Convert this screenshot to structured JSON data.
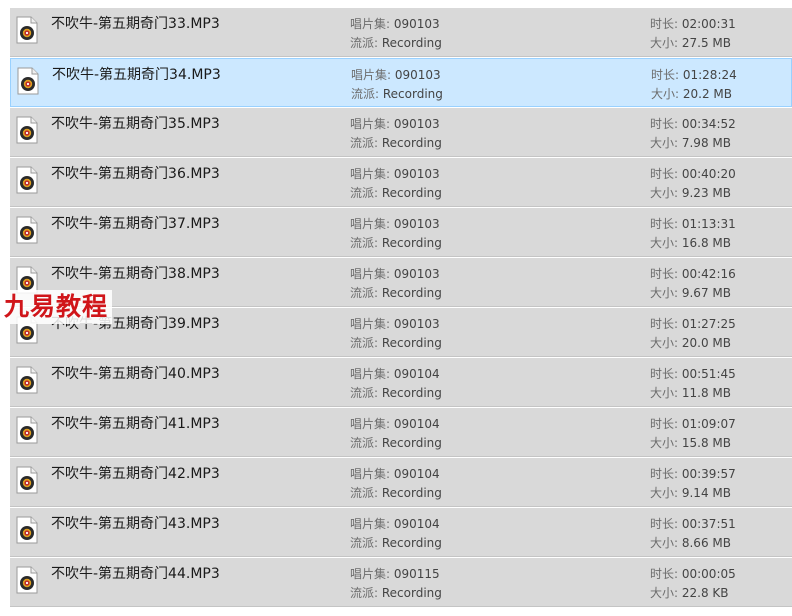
{
  "labels": {
    "album": "唱片集: ",
    "genre": "流派: ",
    "duration": "时长: ",
    "size": "大小: "
  },
  "colors": {
    "row_background": "#d9d9d9",
    "selected_background": "#cce8ff",
    "selected_border": "#99d1ff",
    "watermark": "#d0151a"
  },
  "files": [
    {
      "name": "不吹牛-第五期奇门33.MP3",
      "album": "090103",
      "genre": "Recording",
      "duration": "02:00:31",
      "size": "27.5 MB",
      "selected": false
    },
    {
      "name": "不吹牛-第五期奇门34.MP3",
      "album": "090103",
      "genre": "Recording",
      "duration": "01:28:24",
      "size": "20.2 MB",
      "selected": true
    },
    {
      "name": "不吹牛-第五期奇门35.MP3",
      "album": "090103",
      "genre": "Recording",
      "duration": "00:34:52",
      "size": "7.98 MB",
      "selected": false
    },
    {
      "name": "不吹牛-第五期奇门36.MP3",
      "album": "090103",
      "genre": "Recording",
      "duration": "00:40:20",
      "size": "9.23 MB",
      "selected": false
    },
    {
      "name": "不吹牛-第五期奇门37.MP3",
      "album": "090103",
      "genre": "Recording",
      "duration": "01:13:31",
      "size": "16.8 MB",
      "selected": false
    },
    {
      "name": "不吹牛-第五期奇门38.MP3",
      "album": "090103",
      "genre": "Recording",
      "duration": "00:42:16",
      "size": "9.67 MB",
      "selected": false
    },
    {
      "name": "不吹牛-第五期奇门39.MP3",
      "album": "090103",
      "genre": "Recording",
      "duration": "01:27:25",
      "size": "20.0 MB",
      "selected": false
    },
    {
      "name": "不吹牛-第五期奇门40.MP3",
      "album": "090104",
      "genre": "Recording",
      "duration": "00:51:45",
      "size": "11.8 MB",
      "selected": false
    },
    {
      "name": "不吹牛-第五期奇门41.MP3",
      "album": "090104",
      "genre": "Recording",
      "duration": "01:09:07",
      "size": "15.8 MB",
      "selected": false
    },
    {
      "name": "不吹牛-第五期奇门42.MP3",
      "album": "090104",
      "genre": "Recording",
      "duration": "00:39:57",
      "size": "9.14 MB",
      "selected": false
    },
    {
      "name": "不吹牛-第五期奇门43.MP3",
      "album": "090104",
      "genre": "Recording",
      "duration": "00:37:51",
      "size": "8.66 MB",
      "selected": false
    },
    {
      "name": "不吹牛-第五期奇门44.MP3",
      "album": "090115",
      "genre": "Recording",
      "duration": "00:00:05",
      "size": "22.8 KB",
      "selected": false
    }
  ],
  "file_icon": "audio-file-icon",
  "watermark": "九易教程"
}
